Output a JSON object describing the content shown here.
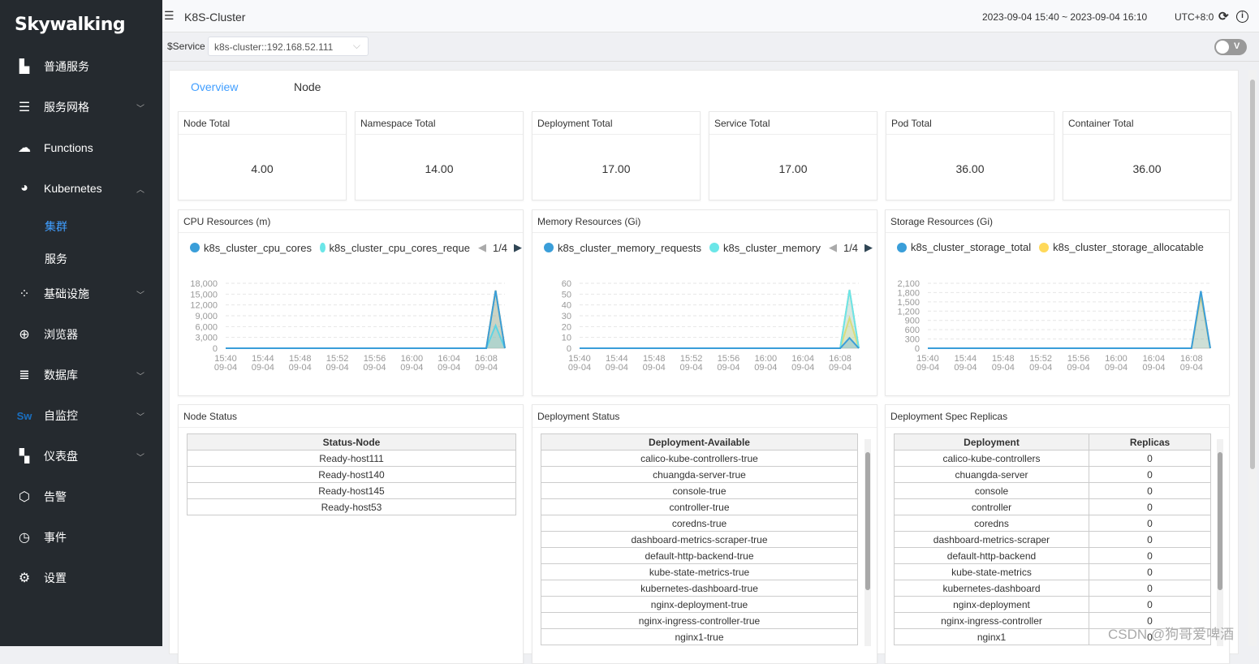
{
  "sidebar": {
    "logo": "Skywalking",
    "items": [
      {
        "label": "普通服务",
        "icon": "bar-chart-icon",
        "chev": false
      },
      {
        "label": "服务网格",
        "icon": "layers-icon",
        "chev": true
      },
      {
        "label": "Functions",
        "icon": "cloud-icon",
        "chev": false
      },
      {
        "label": "Kubernetes",
        "icon": "pie-icon",
        "chev": true,
        "open": true
      },
      {
        "label": "基础设施",
        "icon": "nodes-icon",
        "chev": true
      },
      {
        "label": "浏览器",
        "icon": "globe-icon",
        "chev": false
      },
      {
        "label": "数据库",
        "icon": "database-icon",
        "chev": true
      },
      {
        "label": "自监控",
        "icon": "sw-logo-icon",
        "chev": true
      },
      {
        "label": "仪表盘",
        "icon": "dashboard-add-icon",
        "chev": true
      },
      {
        "label": "告警",
        "icon": "alert-icon",
        "chev": false
      },
      {
        "label": "事件",
        "icon": "event-clock-icon",
        "chev": false
      },
      {
        "label": "设置",
        "icon": "gear-icon",
        "chev": false
      }
    ],
    "subitems": [
      {
        "label": "集群",
        "active": true
      },
      {
        "label": "服务",
        "active": false
      }
    ]
  },
  "header": {
    "title": "K8S-Cluster",
    "time_range": "2023-09-04 15:40 ~ 2023-09-04 16:10",
    "timezone": "UTC+8:0"
  },
  "service_bar": {
    "label": "$Service",
    "value": "k8s-cluster::192.168.52.111",
    "toggle": "V"
  },
  "tabs": [
    {
      "label": "Overview",
      "active": true
    },
    {
      "label": "Node",
      "active": false
    }
  ],
  "stats": [
    {
      "title": "Node Total",
      "value": "4.00"
    },
    {
      "title": "Namespace Total",
      "value": "14.00"
    },
    {
      "title": "Deployment Total",
      "value": "17.00"
    },
    {
      "title": "Service Total",
      "value": "17.00"
    },
    {
      "title": "Pod Total",
      "value": "36.00"
    },
    {
      "title": "Container Total",
      "value": "36.00"
    }
  ],
  "colors": {
    "accent": "#409eff",
    "sidebar": "#252a2f",
    "blue": "#3a9ed9",
    "teal": "#6be6e8",
    "yellow": "#ffd95a",
    "orange": "#f4a97f"
  },
  "chart_data": [
    {
      "type": "area",
      "title": "CPU Resources (m)",
      "legend_page": "1/4",
      "ylim": [
        0,
        18000
      ],
      "yticks": [
        "0",
        "3,000",
        "6,000",
        "9,000",
        "12,000",
        "15,000",
        "18,000"
      ],
      "xticks": [
        "15:40\n09-04",
        "15:44\n09-04",
        "15:48\n09-04",
        "15:52\n09-04",
        "15:56\n09-04",
        "16:00\n09-04",
        "16:04\n09-04",
        "16:08\n09-04"
      ],
      "x": [
        "15:40",
        "16:08",
        "16:09",
        "16:10"
      ],
      "series": [
        {
          "name": "k8s_cluster_cpu_cores",
          "color": "#3a9ed9",
          "values": [
            0,
            0,
            16000,
            0
          ]
        },
        {
          "name": "k8s_cluster_cpu_cores_reque",
          "color": "#6be6e8",
          "values": [
            0,
            0,
            6300,
            0
          ]
        },
        {
          "color": "#ffd95a",
          "values": [
            0,
            0,
            16000,
            0
          ]
        },
        {
          "color": "#f4a97f",
          "values": [
            0,
            0,
            16000,
            0
          ]
        }
      ]
    },
    {
      "type": "area",
      "title": "Memory Resources (Gi)",
      "legend_page": "1/4",
      "ylim": [
        0,
        60
      ],
      "yticks": [
        "0",
        "10",
        "20",
        "30",
        "40",
        "50",
        "60"
      ],
      "xticks": [
        "15:40\n09-04",
        "15:44\n09-04",
        "15:48\n09-04",
        "15:52\n09-04",
        "15:56\n09-04",
        "16:00\n09-04",
        "16:04\n09-04",
        "16:08\n09-04"
      ],
      "x": [
        "15:40",
        "16:08",
        "16:09",
        "16:10"
      ],
      "series": [
        {
          "name": "k8s_cluster_memory_requests",
          "color": "#3a9ed9",
          "values": [
            0,
            0,
            9.5,
            0
          ]
        },
        {
          "name": "k8s_cluster_memory",
          "color": "#6be6e8",
          "values": [
            0,
            0,
            54,
            0
          ]
        },
        {
          "color": "#ffd95a",
          "values": [
            0,
            0,
            28,
            0
          ]
        },
        {
          "color": "#f4a97f",
          "values": [
            0,
            0,
            54,
            0
          ]
        }
      ]
    },
    {
      "type": "area",
      "title": "Storage Resources (Gi)",
      "ylim": [
        0,
        2100
      ],
      "yticks": [
        "0",
        "300",
        "600",
        "900",
        "1,200",
        "1,500",
        "1,800",
        "2,100"
      ],
      "xticks": [
        "15:40\n09-04",
        "15:44\n09-04",
        "15:48\n09-04",
        "15:52\n09-04",
        "15:56\n09-04",
        "16:00\n09-04",
        "16:04\n09-04",
        "16:08\n09-04"
      ],
      "x": [
        "15:40",
        "16:08",
        "16:09",
        "16:10"
      ],
      "series": [
        {
          "name": "k8s_cluster_storage_total",
          "color": "#3a9ed9",
          "values": [
            0,
            0,
            1850,
            0
          ]
        },
        {
          "name": "k8s_cluster_storage_allocatable",
          "color": "#ffd95a",
          "values": [
            0,
            0,
            1700,
            0
          ]
        }
      ]
    }
  ],
  "node_status": {
    "title": "Node Status",
    "header": "Status-Node",
    "rows": [
      "Ready-host111",
      "Ready-host140",
      "Ready-host145",
      "Ready-host53"
    ]
  },
  "deployment_status": {
    "title": "Deployment Status",
    "header": "Deployment-Available",
    "rows": [
      "calico-kube-controllers-true",
      "chuangda-server-true",
      "console-true",
      "controller-true",
      "coredns-true",
      "dashboard-metrics-scraper-true",
      "default-http-backend-true",
      "kube-state-metrics-true",
      "kubernetes-dashboard-true",
      "nginx-deployment-true",
      "nginx-ingress-controller-true",
      "nginx1-true"
    ]
  },
  "replicas": {
    "title": "Deployment Spec Replicas",
    "headers": [
      "Deployment",
      "Replicas"
    ],
    "rows": [
      [
        "calico-kube-controllers",
        "0"
      ],
      [
        "chuangda-server",
        "0"
      ],
      [
        "console",
        "0"
      ],
      [
        "controller",
        "0"
      ],
      [
        "coredns",
        "0"
      ],
      [
        "dashboard-metrics-scraper",
        "0"
      ],
      [
        "default-http-backend",
        "0"
      ],
      [
        "kube-state-metrics",
        "0"
      ],
      [
        "kubernetes-dashboard",
        "0"
      ],
      [
        "nginx-deployment",
        "0"
      ],
      [
        "nginx-ingress-controller",
        "0"
      ],
      [
        "nginx1",
        "0"
      ]
    ]
  },
  "watermark": "CSDN @狗哥爱啤酒"
}
